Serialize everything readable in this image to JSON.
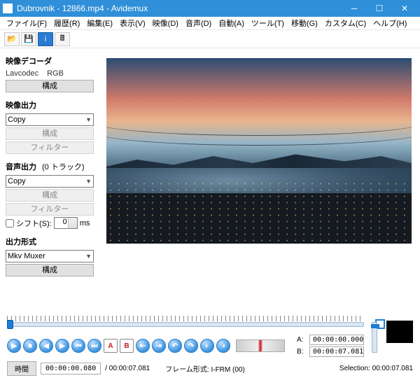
{
  "window": {
    "title": "Dubrovnik - 12866.mp4 - Avidemux"
  },
  "menu": {
    "file": "ファイル(F)",
    "recent": "履歴(R)",
    "edit": "編集(E)",
    "view": "表示(V)",
    "video": "映像(D)",
    "audio": "音声(D)",
    "auto": "自動(A)",
    "tools": "ツール(T)",
    "move": "移動(G)",
    "custom": "カスタム(C)",
    "help": "ヘルプ(H)"
  },
  "decoder": {
    "title": "映像デコーダ",
    "codec": "Lavcodec",
    "mode": "RGB",
    "config": "構成"
  },
  "video_out": {
    "title": "映像出力",
    "value": "Copy",
    "config": "構成",
    "filter": "フィルター"
  },
  "audio_out": {
    "title": "音声出力",
    "tracks": "(0 トラック)",
    "value": "Copy",
    "config": "構成",
    "filter": "フィルター",
    "shift_label": "シフト(S):",
    "shift_value": "0",
    "shift_unit": "ms"
  },
  "format": {
    "title": "出力形式",
    "value": "Mkv Muxer",
    "config": "構成"
  },
  "marks": {
    "A": "A:",
    "A_val": "00:00:00.000",
    "B": "B:",
    "B_val": "00:00:07.081"
  },
  "status": {
    "time_btn": "時間",
    "time_val": "00:00:00.080",
    "duration": "/ 00:00:07.081",
    "frame": "フレーム形式: I-FRM (00)",
    "selection": "Selection: 00:00:07.081"
  },
  "nav_sq": {
    "A": "A",
    "B": "B"
  }
}
